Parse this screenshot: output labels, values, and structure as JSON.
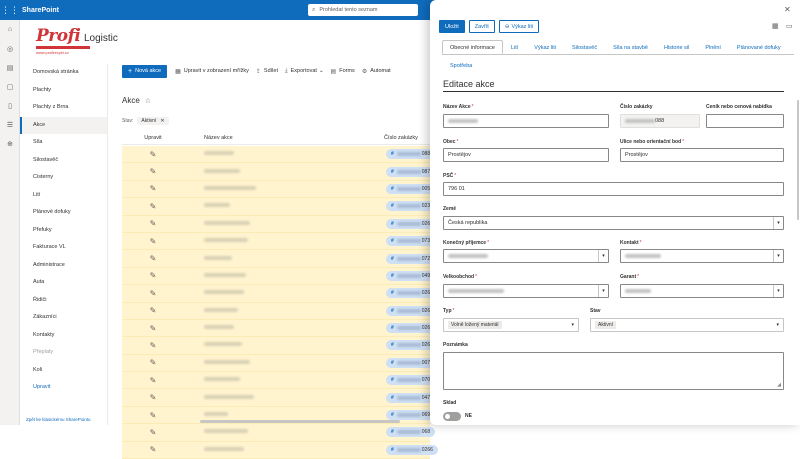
{
  "suitebar": {
    "app_name": "SharePoint",
    "search_placeholder": "Prohledat tento seznam"
  },
  "site": {
    "logo_text": "Profi",
    "logo_sub": "www.profirecykl.cz",
    "title": "Logistic"
  },
  "nav": {
    "items": [
      {
        "label": "Domovská stránka"
      },
      {
        "label": "Plachty"
      },
      {
        "label": "Plachty z Brna"
      },
      {
        "label": "Akce"
      },
      {
        "label": "Síla"
      },
      {
        "label": "Silostavěč"
      },
      {
        "label": "Cisterny"
      },
      {
        "label": "Lití"
      },
      {
        "label": "Plánové dofuky"
      },
      {
        "label": "Přefuky"
      },
      {
        "label": "Fakturace VL"
      },
      {
        "label": "Administrace"
      },
      {
        "label": "Auta"
      },
      {
        "label": "Řidiči"
      },
      {
        "label": "Zákazníci"
      },
      {
        "label": "Kontakty"
      },
      {
        "label": "Přeplaty"
      },
      {
        "label": "Koli"
      },
      {
        "label": "Upravit"
      }
    ],
    "footer": "Zpět ke klasickému SharePointu"
  },
  "commandbar": {
    "new": "Nová akce",
    "edit_grid": "Upravit v zobrazení mřížky",
    "share": "Sdílet",
    "export": "Exportovat",
    "forms": "Forms",
    "automate": "Automat"
  },
  "list": {
    "title": "Akce",
    "filter_label": "Stav:",
    "filter_value": "Aktivní",
    "columns": {
      "edit": "Upravit",
      "name": "Název akce",
      "number": "Číslo zakázky"
    },
    "rows": [
      {
        "num_suffix": "088"
      },
      {
        "num_suffix": "087"
      },
      {
        "num_suffix": "005"
      },
      {
        "num_suffix": "023"
      },
      {
        "num_suffix": "0265"
      },
      {
        "num_suffix": "073"
      },
      {
        "num_suffix": "072"
      },
      {
        "num_suffix": "049"
      },
      {
        "num_suffix": "0264"
      },
      {
        "num_suffix": "0263"
      },
      {
        "num_suffix": "0262"
      },
      {
        "num_suffix": "0261"
      },
      {
        "num_suffix": "0079"
      },
      {
        "num_suffix": "070"
      },
      {
        "num_suffix": "047"
      },
      {
        "num_suffix": "069"
      },
      {
        "num_suffix": "068"
      },
      {
        "num_suffix": "0266"
      }
    ]
  },
  "panel": {
    "buttons": {
      "save": "Uložit",
      "close": "Zavřít",
      "report": "Výkaz liti"
    },
    "tabs": [
      "Obecné informace",
      "Lití",
      "Výkaz liti",
      "Silostavěč",
      "Síla na stavbě",
      "Historie sil",
      "Plnění",
      "Plánované dofuky",
      "Spotřeba"
    ],
    "form_title": "Editace akce",
    "fields": {
      "nazev_label": "Název Akce",
      "cislo_label": "Číslo zakázky",
      "cislo_suffix": "088",
      "cenik_label": "Ceník nebo cenová nabídka",
      "obec_label": "Obec",
      "obec_value": "Prostějov",
      "ulice_label": "Ulice nebo orientační bod",
      "ulice_value": "Prostějov",
      "psc_label": "PSČ",
      "psc_value": "796 01",
      "zeme_label": "Země",
      "zeme_value": "Česká republika",
      "prijemce_label": "Konečný příjemce",
      "kontakt_label": "Kontakt",
      "velko_label": "Velkoobchod",
      "garant_label": "Garant",
      "typ_label": "Typ",
      "typ_value": "Volně ložený materiál",
      "stav_label": "Stav",
      "stav_value": "Aktivní",
      "poznamka_label": "Poznámka",
      "sklad_label": "Sklad",
      "sklad_value": "NE"
    }
  }
}
